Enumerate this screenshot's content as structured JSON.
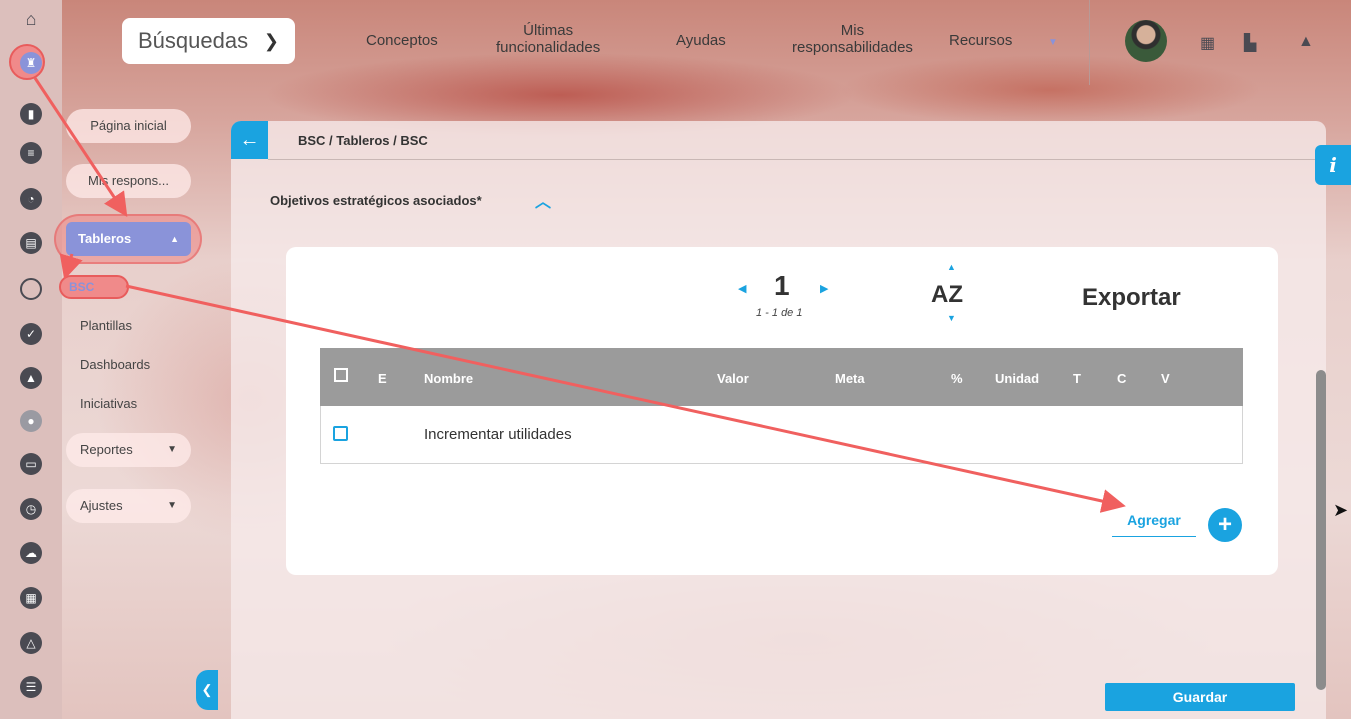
{
  "header": {
    "search_label": "Búsquedas",
    "nav": [
      {
        "label": "Conceptos"
      },
      {
        "label": "Últimas\nfuncionalidades"
      },
      {
        "label": "Ayudas"
      },
      {
        "label": "Mis\nresponsabilidades"
      },
      {
        "label": "Recursos"
      }
    ]
  },
  "sidebar": {
    "home_label": "Página inicial",
    "resp_label": "Mis respons...",
    "tableros_label": "Tableros",
    "bsc_label": "BSC",
    "plantillas_label": "Plantillas",
    "dashboards_label": "Dashboards",
    "iniciativas_label": "Iniciativas",
    "reportes_label": "Reportes",
    "ajustes_label": "Ajustes"
  },
  "main": {
    "breadcrumb": "BSC / Tableros / BSC",
    "section_title": "Objetivos estratégicos asociados*",
    "pager": {
      "page": "1",
      "range": "1 - 1 de 1"
    },
    "sort_label": "AZ",
    "export_label": "Exportar",
    "table": {
      "headers": {
        "e": "E",
        "nombre": "Nombre",
        "valor": "Valor",
        "meta": "Meta",
        "pct": "%",
        "unidad": "Unidad",
        "t": "T",
        "c": "C",
        "v": "V"
      },
      "rows": [
        {
          "nombre": "Incrementar utilidades"
        }
      ]
    },
    "add_label": "Agregar",
    "add_icon": "+",
    "save_label": "Guardar",
    "info_label": "i"
  },
  "colors": {
    "accent": "#1aa3e0",
    "annotation": "#f0605f",
    "table_header": "#9b9b9b",
    "tab_active": "#8a93d9"
  }
}
